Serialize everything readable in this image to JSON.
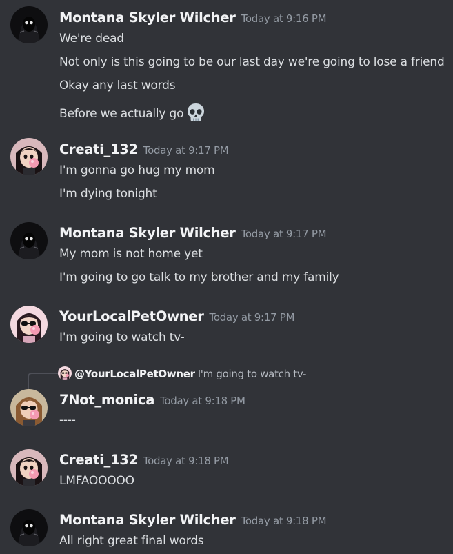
{
  "messages": [
    {
      "author": "Montana Skyler Wilcher",
      "timestamp": "Today at 9:16 PM",
      "avatar": "dark-hooded-figure-avatar",
      "lines": [
        "We're dead",
        "Not only is this going to be our last day we're going to lose a friend",
        "Okay any last words",
        "Before we actually go"
      ],
      "emoji": "skull-emoji"
    },
    {
      "author": "Creati_132",
      "timestamp": "Today at 9:17 PM",
      "avatar": "girl-bubblegum-avatar",
      "lines": [
        "I'm gonna go hug my mom",
        "I'm dying tonight"
      ]
    },
    {
      "author": "Montana Skyler Wilcher",
      "timestamp": "Today at 9:17 PM",
      "avatar": "dark-hooded-figure-avatar",
      "lines": [
        "My mom is not home yet",
        "I'm going to go talk to my brother and my family"
      ]
    },
    {
      "author": "YourLocalPetOwner",
      "timestamp": "Today at 9:17 PM",
      "avatar": "pink-sunglasses-avatar",
      "lines": [
        "I'm going to watch tv-"
      ]
    },
    {
      "author": "7Not_monica",
      "timestamp": "Today at 9:18 PM",
      "avatar": "brown-hair-sunglasses-avatar",
      "reply": {
        "author": "@YourLocalPetOwner",
        "text": "I'm going to watch tv-"
      },
      "lines": [
        "----"
      ]
    },
    {
      "author": "Creati_132",
      "timestamp": "Today at 9:18 PM",
      "avatar": "girl-bubblegum-avatar",
      "lines": [
        "LMFAOOOOO"
      ]
    },
    {
      "author": "Montana Skyler Wilcher",
      "timestamp": "Today at 9:18 PM",
      "avatar": "dark-hooded-figure-avatar",
      "lines": [
        "All right great final words"
      ]
    }
  ],
  "colors": {
    "background": "#313338",
    "username": "#f2f3f5",
    "timestamp": "#949ba4",
    "message_text": "#dbdee1"
  }
}
